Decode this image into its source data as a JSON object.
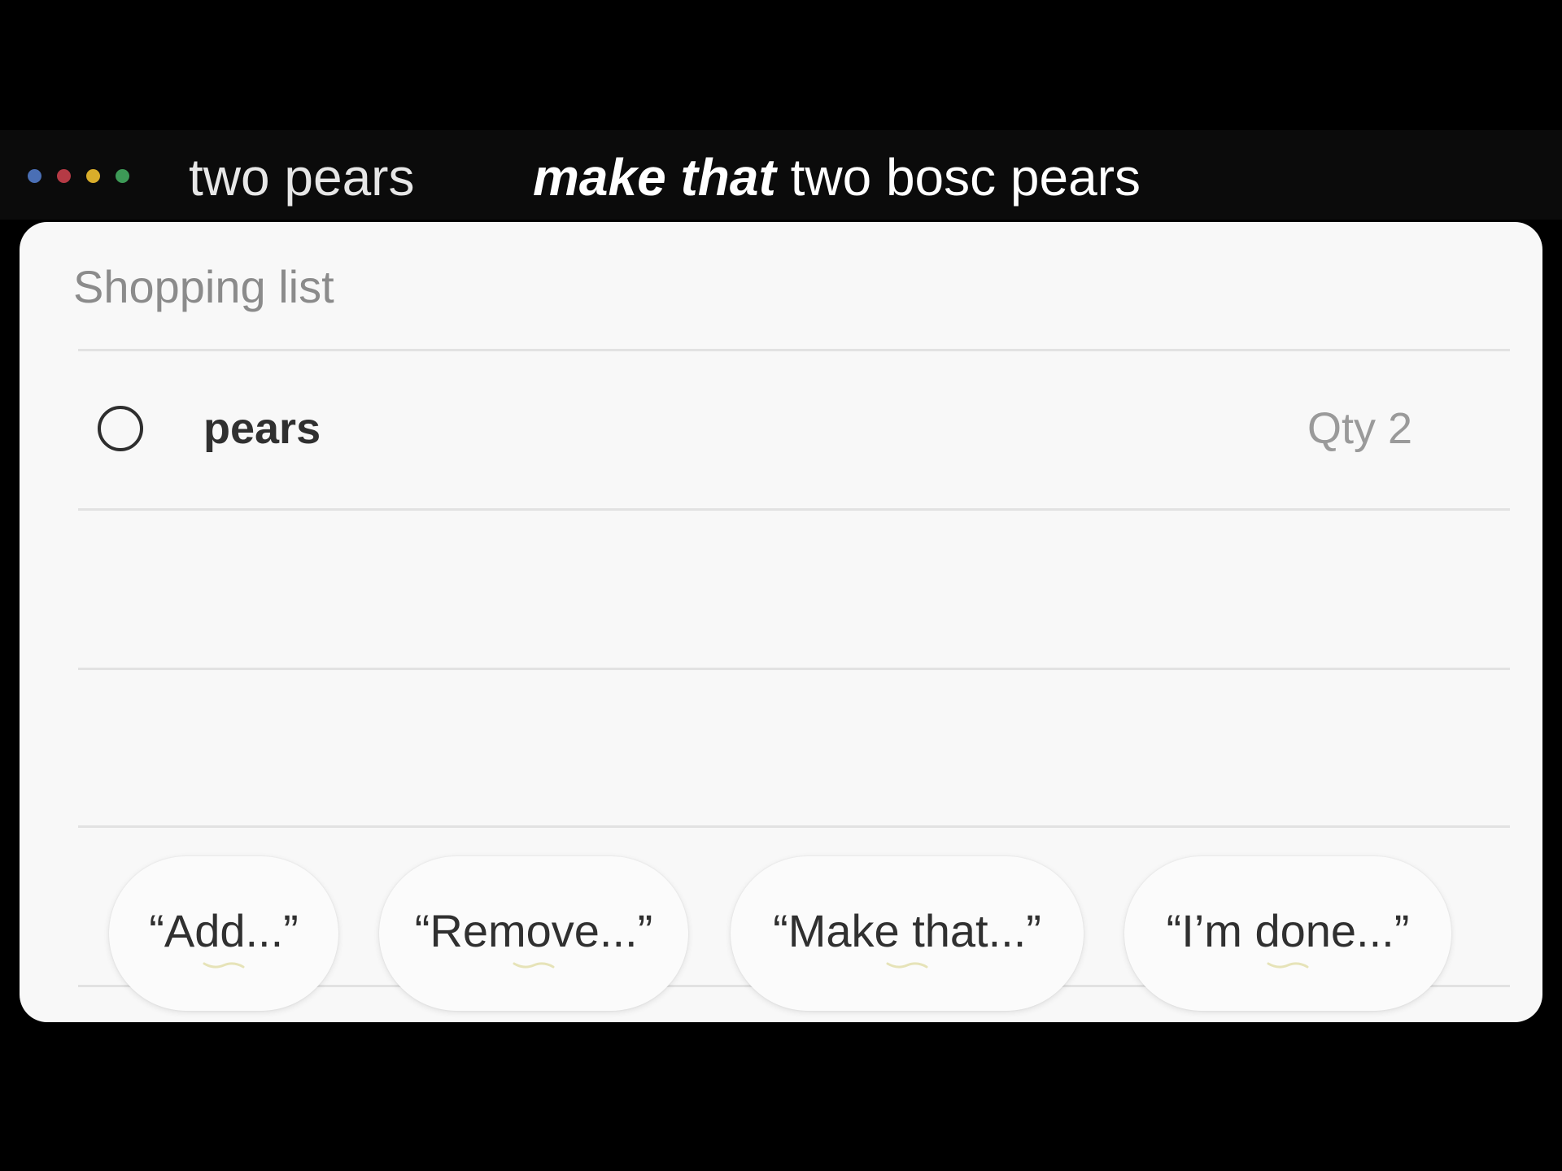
{
  "assistant_bar": {
    "indicator_icon": "assistant-dots-icon",
    "dot_colors": [
      "#4a6fb5",
      "#b53a45",
      "#d9ad2a",
      "#3d9a57"
    ],
    "previous_query": "two pears",
    "current_query": {
      "emphasis": "make that",
      "rest": " two bosc pears"
    }
  },
  "card": {
    "title": "Shopping list",
    "items": [
      {
        "name": "pears",
        "quantity": "Qty 2",
        "checked": false,
        "checkbox_icon": "empty-circle-icon"
      }
    ]
  },
  "suggestions": [
    {
      "label": "“Add...”"
    },
    {
      "label": "“Remove...”"
    },
    {
      "label": "“Make that...”"
    },
    {
      "label": "“I’m done...”"
    }
  ],
  "colors": {
    "background": "#000000",
    "card_background": "#f8f8f8",
    "muted_text": "#8b8b8b",
    "primary_text": "#303030",
    "divider": "#e2e2e2"
  }
}
